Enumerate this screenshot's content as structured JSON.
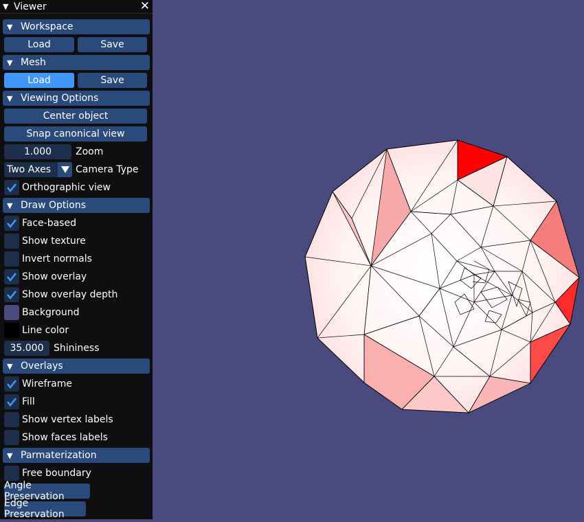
{
  "window": {
    "title": "Viewer"
  },
  "sections": {
    "workspace": {
      "label": "Workspace",
      "load": "Load",
      "save": "Save"
    },
    "mesh": {
      "label": "Mesh",
      "load": "Load",
      "save": "Save"
    },
    "viewing": {
      "label": "Viewing Options",
      "center": "Center object",
      "snap": "Snap canonical view",
      "zoom_value": "1.000",
      "zoom_label": "Zoom",
      "camera_value": "Two Axes",
      "camera_label": "Camera Type",
      "ortho_label": "Orthographic view",
      "ortho_checked": true
    },
    "draw": {
      "label": "Draw Options",
      "face_based": "Face-based",
      "show_texture": "Show texture",
      "invert_normals": "Invert normals",
      "show_overlay": "Show overlay",
      "show_overlay_depth": "Show overlay depth",
      "background": "Background",
      "background_color": "#4b4a7f",
      "line_color": "Line color",
      "line_color_value": "#000000",
      "shininess_value": "35.000",
      "shininess_label": "Shininess"
    },
    "overlays": {
      "label": "Overlays",
      "wireframe": "Wireframe",
      "fill": "Fill",
      "vertex_labels": "Show vertex labels",
      "face_labels": "Show faces labels"
    },
    "param": {
      "label": "Parmaterization",
      "free_boundary": "Free boundary",
      "angle": "Angle Preservation",
      "edge": "Edge Preservation"
    }
  },
  "colors": {
    "panel": "#0f0f11",
    "header": "#294a7a",
    "active": "#4296fa",
    "viewport": "#4b4a7f",
    "highlight_face": "#ff0000"
  }
}
